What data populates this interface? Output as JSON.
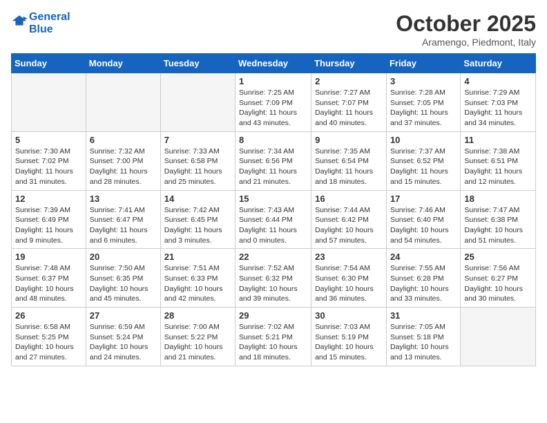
{
  "logo": {
    "line1": "General",
    "line2": "Blue"
  },
  "title": "October 2025",
  "subtitle": "Aramengo, Piedmont, Italy",
  "weekdays": [
    "Sunday",
    "Monday",
    "Tuesday",
    "Wednesday",
    "Thursday",
    "Friday",
    "Saturday"
  ],
  "weeks": [
    [
      {
        "day": "",
        "info": ""
      },
      {
        "day": "",
        "info": ""
      },
      {
        "day": "",
        "info": ""
      },
      {
        "day": "1",
        "info": "Sunrise: 7:25 AM\nSunset: 7:09 PM\nDaylight: 11 hours and 43 minutes."
      },
      {
        "day": "2",
        "info": "Sunrise: 7:27 AM\nSunset: 7:07 PM\nDaylight: 11 hours and 40 minutes."
      },
      {
        "day": "3",
        "info": "Sunrise: 7:28 AM\nSunset: 7:05 PM\nDaylight: 11 hours and 37 minutes."
      },
      {
        "day": "4",
        "info": "Sunrise: 7:29 AM\nSunset: 7:03 PM\nDaylight: 11 hours and 34 minutes."
      }
    ],
    [
      {
        "day": "5",
        "info": "Sunrise: 7:30 AM\nSunset: 7:02 PM\nDaylight: 11 hours and 31 minutes."
      },
      {
        "day": "6",
        "info": "Sunrise: 7:32 AM\nSunset: 7:00 PM\nDaylight: 11 hours and 28 minutes."
      },
      {
        "day": "7",
        "info": "Sunrise: 7:33 AM\nSunset: 6:58 PM\nDaylight: 11 hours and 25 minutes."
      },
      {
        "day": "8",
        "info": "Sunrise: 7:34 AM\nSunset: 6:56 PM\nDaylight: 11 hours and 21 minutes."
      },
      {
        "day": "9",
        "info": "Sunrise: 7:35 AM\nSunset: 6:54 PM\nDaylight: 11 hours and 18 minutes."
      },
      {
        "day": "10",
        "info": "Sunrise: 7:37 AM\nSunset: 6:52 PM\nDaylight: 11 hours and 15 minutes."
      },
      {
        "day": "11",
        "info": "Sunrise: 7:38 AM\nSunset: 6:51 PM\nDaylight: 11 hours and 12 minutes."
      }
    ],
    [
      {
        "day": "12",
        "info": "Sunrise: 7:39 AM\nSunset: 6:49 PM\nDaylight: 11 hours and 9 minutes."
      },
      {
        "day": "13",
        "info": "Sunrise: 7:41 AM\nSunset: 6:47 PM\nDaylight: 11 hours and 6 minutes."
      },
      {
        "day": "14",
        "info": "Sunrise: 7:42 AM\nSunset: 6:45 PM\nDaylight: 11 hours and 3 minutes."
      },
      {
        "day": "15",
        "info": "Sunrise: 7:43 AM\nSunset: 6:44 PM\nDaylight: 11 hours and 0 minutes."
      },
      {
        "day": "16",
        "info": "Sunrise: 7:44 AM\nSunset: 6:42 PM\nDaylight: 10 hours and 57 minutes."
      },
      {
        "day": "17",
        "info": "Sunrise: 7:46 AM\nSunset: 6:40 PM\nDaylight: 10 hours and 54 minutes."
      },
      {
        "day": "18",
        "info": "Sunrise: 7:47 AM\nSunset: 6:38 PM\nDaylight: 10 hours and 51 minutes."
      }
    ],
    [
      {
        "day": "19",
        "info": "Sunrise: 7:48 AM\nSunset: 6:37 PM\nDaylight: 10 hours and 48 minutes."
      },
      {
        "day": "20",
        "info": "Sunrise: 7:50 AM\nSunset: 6:35 PM\nDaylight: 10 hours and 45 minutes."
      },
      {
        "day": "21",
        "info": "Sunrise: 7:51 AM\nSunset: 6:33 PM\nDaylight: 10 hours and 42 minutes."
      },
      {
        "day": "22",
        "info": "Sunrise: 7:52 AM\nSunset: 6:32 PM\nDaylight: 10 hours and 39 minutes."
      },
      {
        "day": "23",
        "info": "Sunrise: 7:54 AM\nSunset: 6:30 PM\nDaylight: 10 hours and 36 minutes."
      },
      {
        "day": "24",
        "info": "Sunrise: 7:55 AM\nSunset: 6:28 PM\nDaylight: 10 hours and 33 minutes."
      },
      {
        "day": "25",
        "info": "Sunrise: 7:56 AM\nSunset: 6:27 PM\nDaylight: 10 hours and 30 minutes."
      }
    ],
    [
      {
        "day": "26",
        "info": "Sunrise: 6:58 AM\nSunset: 5:25 PM\nDaylight: 10 hours and 27 minutes."
      },
      {
        "day": "27",
        "info": "Sunrise: 6:59 AM\nSunset: 5:24 PM\nDaylight: 10 hours and 24 minutes."
      },
      {
        "day": "28",
        "info": "Sunrise: 7:00 AM\nSunset: 5:22 PM\nDaylight: 10 hours and 21 minutes."
      },
      {
        "day": "29",
        "info": "Sunrise: 7:02 AM\nSunset: 5:21 PM\nDaylight: 10 hours and 18 minutes."
      },
      {
        "day": "30",
        "info": "Sunrise: 7:03 AM\nSunset: 5:19 PM\nDaylight: 10 hours and 15 minutes."
      },
      {
        "day": "31",
        "info": "Sunrise: 7:05 AM\nSunset: 5:18 PM\nDaylight: 10 hours and 13 minutes."
      },
      {
        "day": "",
        "info": ""
      }
    ]
  ]
}
